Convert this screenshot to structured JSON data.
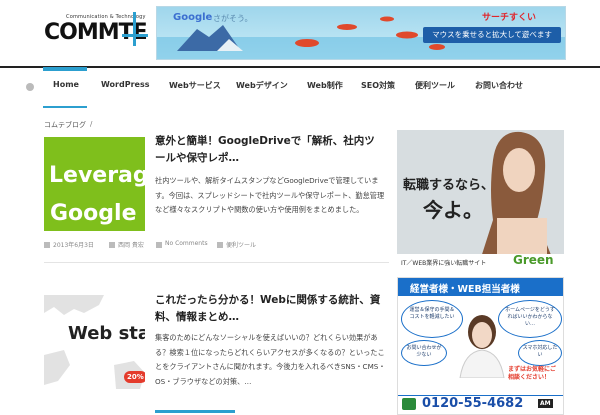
{
  "header": {
    "logo_text": "COMMTE",
    "logo_sub": "Communication & Technology",
    "banner": {
      "google_text": "Google",
      "sagasou": "さがそう。",
      "search_brand": "サーチすくい",
      "tagline": "マウスを乗せると拡大して遊べます"
    }
  },
  "nav": {
    "items": [
      {
        "label": "Home"
      },
      {
        "label": "WordPress"
      },
      {
        "label": "Webサービス"
      },
      {
        "label": "Webデザイン"
      },
      {
        "label": "Web制作"
      },
      {
        "label": "SEO対策"
      },
      {
        "label": "便利ツール"
      },
      {
        "label": "お問い合わせ"
      }
    ]
  },
  "breadcrumb": {
    "label": "コムテブログ",
    "sep": "/"
  },
  "posts": [
    {
      "title": "意外と簡単！GoogleDriveで「解析、社内ツールや保守レポ…",
      "excerpt": "社内ツールや、解析タイムスタンプなどGoogleDriveで管理しています。今回は、スプレッドシートで社内ツールや保守レポート、勤怠管理など様々なスクリプトや関数の使い方や使用例をまとめました。",
      "thumb_text_1": "Leverag",
      "thumb_text_2": "Google",
      "meta_date": "2013年6月3日",
      "meta_author": "西岡 貴宏",
      "meta_comments": "No Comments",
      "meta_category": "便利ツール"
    },
    {
      "title": "これだったら分かる！Webに関係する統計、資料、情報まとめ…",
      "excerpt": "集客のためにどんなソーシャルを使えばいいの？どれくらい効果がある？検索１位になったらどれくらいアクセスが多くなるの？といったことをクライアントさんに聞かれます。今後力を入れるべきSNS・CMS・OS・ブラウザなどの対策、…",
      "thumb_text": "Web sta",
      "thumb_badge": "20%"
    }
  ],
  "sidebar": {
    "ad1": {
      "headline_1": "転職するなら、",
      "headline_2": "今よ。",
      "footer": "IT／WEB業界に強い転職サイト",
      "brand": "Green"
    },
    "ad2": {
      "title": "経営者様・WEB担当者様",
      "bubble_1": "運営＆保守の手間＆コストを軽減したい",
      "bubble_2": "ホームページをどうすればいいかわからない…",
      "bubble_3": "お問い合わせが少ない",
      "bubble_4": "スマホ対応したい",
      "cta": "まずはお気軽にご相談ください！",
      "phone": "0120-55-4682",
      "phone_badge": "AM"
    }
  },
  "colors": {
    "accent": "#2c9fcf",
    "thumb_green": "#7fbf1c",
    "ad2_blue": "#1a6fc9"
  }
}
